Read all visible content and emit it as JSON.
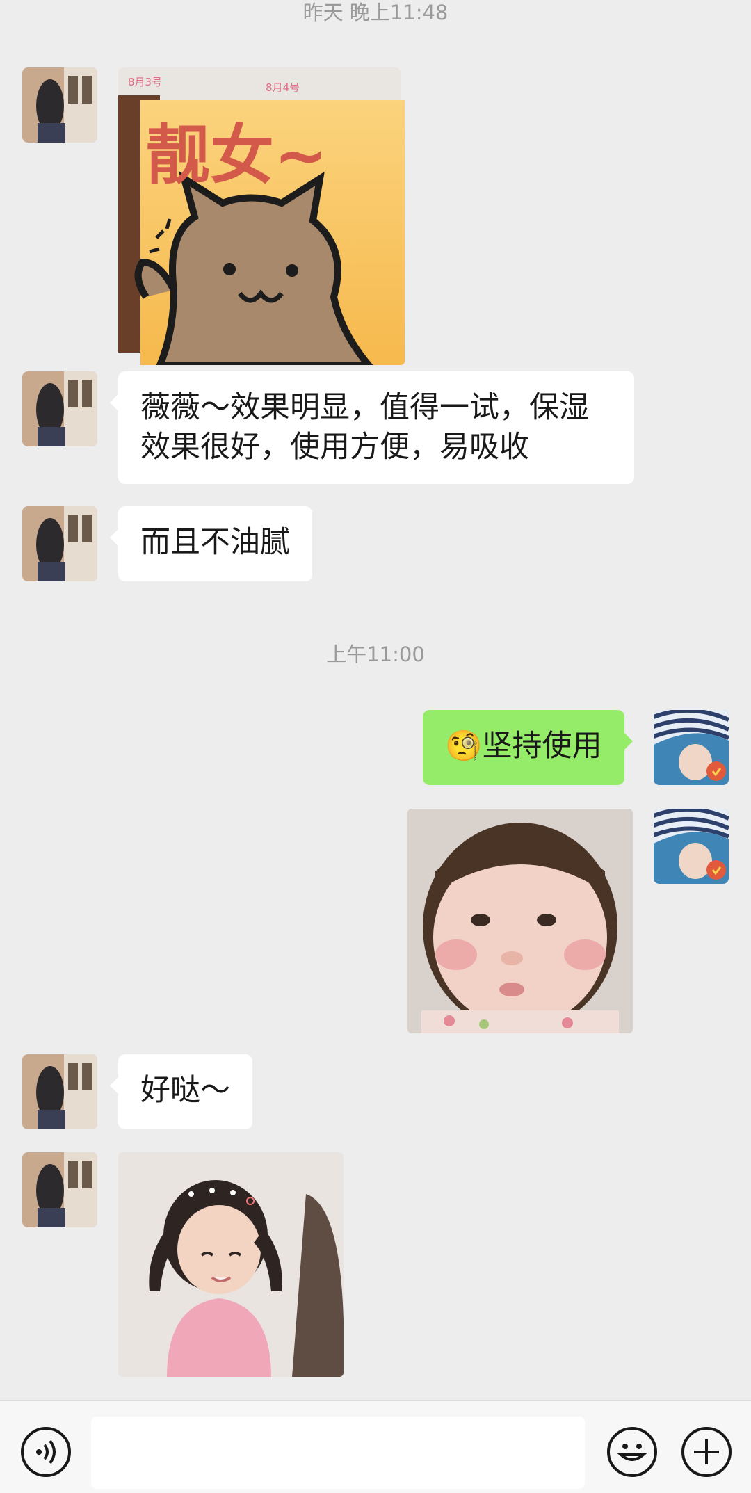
{
  "timestamps": {
    "yesterday": "昨天 晚上11:48",
    "morning": "上午11:00"
  },
  "sticker_kitten": {
    "text": "靓女~",
    "photo_label_left": "8月3号",
    "photo_label_right": "8月4号"
  },
  "messages": {
    "m1": {
      "lines": [
        "薇薇～效果明显，值得一试，保湿",
        "效果很好，使用方便，易吸收"
      ]
    },
    "m2": {
      "text": "而且不油腻"
    },
    "m3": {
      "emoji": "🧐",
      "text": "坚持使用"
    },
    "m4": {
      "text": "好哒～"
    }
  },
  "colors": {
    "background": "#ededed",
    "bubble_received": "#ffffff",
    "bubble_sent": "#95ec69",
    "timestamp": "#9a9a9a"
  },
  "input_bar": {
    "voice_icon": "voice-icon",
    "emoji_icon": "emoji-icon",
    "plus_icon": "plus-icon"
  }
}
